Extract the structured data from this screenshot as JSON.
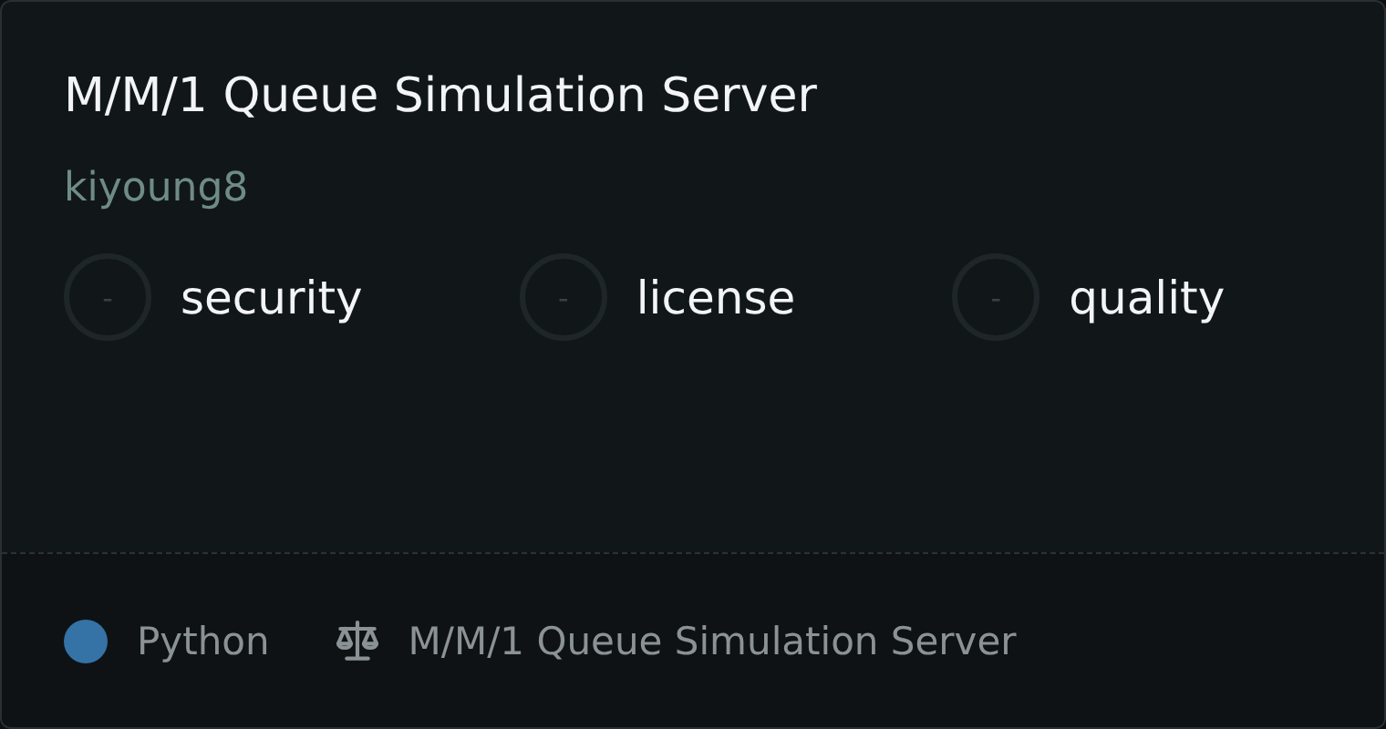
{
  "card": {
    "title": "M/M/1 Queue Simulation Server",
    "author": "kiyoung8"
  },
  "scores": [
    {
      "grade": "-",
      "label": "security"
    },
    {
      "grade": "-",
      "label": "license"
    },
    {
      "grade": "-",
      "label": "quality"
    }
  ],
  "footer": {
    "language": {
      "name": "Python",
      "color": "#3572a5"
    },
    "license": "M/M/1 Queue Simulation Server"
  }
}
